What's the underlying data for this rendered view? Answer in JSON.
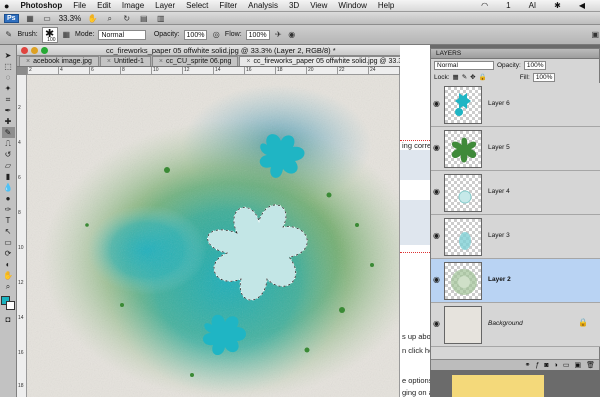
{
  "menubar": {
    "apple_icon": "apple-icon",
    "app": "Photoshop",
    "items": [
      "File",
      "Edit",
      "Image",
      "Layer",
      "Select",
      "Filter",
      "Analysis",
      "3D",
      "View",
      "Window",
      "Help"
    ],
    "status": {
      "badge": "1",
      "ai": "AI"
    }
  },
  "appbar": {
    "badge": "Ps",
    "zoom": "33.3%"
  },
  "options": {
    "brush_label": "Brush:",
    "brush_size": "100",
    "mode_label": "Mode:",
    "mode_value": "Normal",
    "opacity_label": "Opacity:",
    "opacity_value": "100%",
    "flow_label": "Flow:",
    "flow_value": "100%"
  },
  "document": {
    "title": "cc_fireworks_paper 05 offwhite solid.jpg @ 33.3% (Layer 2, RGB/8) *",
    "tabs": [
      {
        "label": "acebook image.jpg"
      },
      {
        "label": "Untitled-1"
      },
      {
        "label": "cc_CU_sprite 06.png"
      },
      {
        "label": "cc_fireworks_paper 05 offwhite solid.jpg @ 33.3% (Layer 2, RGB/8) *"
      }
    ],
    "ruler_h": [
      "2",
      "4",
      "6",
      "8",
      "10",
      "12",
      "14",
      "16",
      "18",
      "20",
      "22",
      "24"
    ],
    "ruler_v": [
      "2",
      "4",
      "6",
      "8",
      "10",
      "12",
      "14",
      "16",
      "18"
    ]
  },
  "background_page": {
    "line1": "ing correctly",
    "line2": "s up above",
    "line3": "n click he",
    "line4": "e options",
    "line5": "ging on a bit"
  },
  "layers_panel": {
    "title": "LAYERS",
    "blend_mode": "Normal",
    "opacity_label": "Opacity:",
    "opacity_value": "100%",
    "lock_label": "Lock:",
    "fill_label": "Fill:",
    "fill_value": "100%",
    "layers": [
      {
        "name": "Layer 6",
        "selected": false
      },
      {
        "name": "Layer 5",
        "selected": false
      },
      {
        "name": "Layer 4",
        "selected": false
      },
      {
        "name": "Layer 3",
        "selected": false
      },
      {
        "name": "Layer 2",
        "selected": true
      },
      {
        "name": "Background",
        "selected": false
      }
    ]
  },
  "colors": {
    "foreground": "#1ab3c0",
    "background": "#ffffff",
    "spray_green": "#3f8a3a",
    "spray_teal": "#1ab0bf",
    "selection": "#2d83c8"
  }
}
